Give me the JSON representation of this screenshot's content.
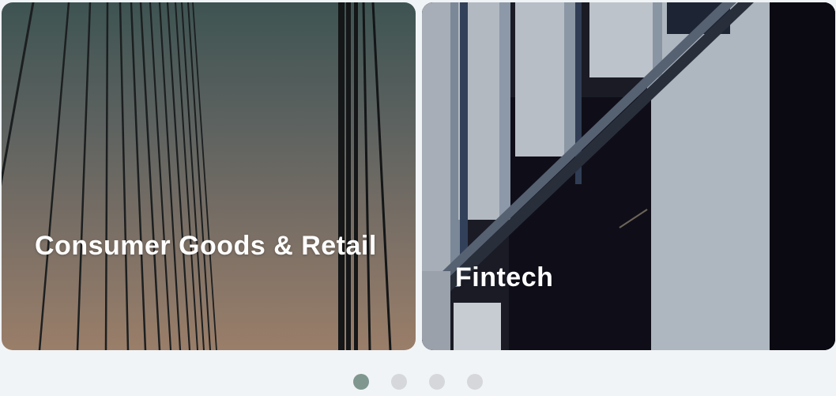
{
  "cards": [
    {
      "title": "Consumer Goods & Retail",
      "image": "bridge-cables-photo"
    },
    {
      "title": "Fintech",
      "image": "building-facade-photo"
    }
  ],
  "pagination": {
    "total": 4,
    "active_index": 0,
    "active_color": "#809790",
    "inactive_color": "#d5d7da"
  }
}
